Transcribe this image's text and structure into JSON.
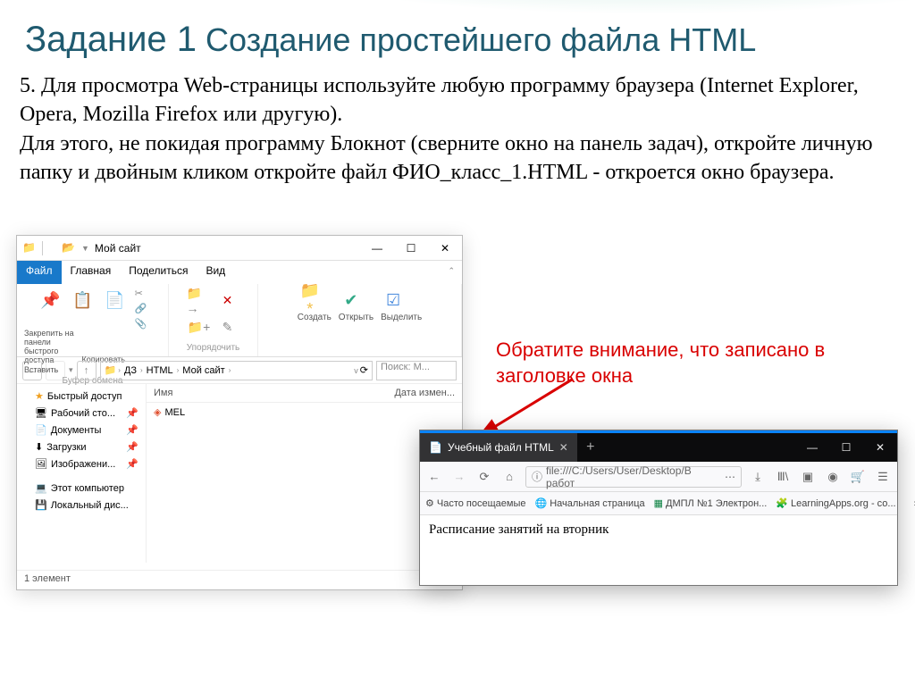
{
  "title_big": "Задание 1",
  "title_rest": "Создание простейшего файла HTML",
  "body_text": "5. Для просмотра Web-страницы используйте любую программу браузера (Internet Explorer, Opera, Mozilla Firefox или другую).\nДля этого, не покидая программу Блокнот (сверните окно на панель задач), откройте личную папку и двойным кликом откройте файл ФИО_класс_1.HTML   - откроется окно браузера.",
  "red_note": "Обратите внимание, что записано в заголовке окна",
  "explorer": {
    "window_title": "Мой сайт",
    "tabs": [
      "Файл",
      "Главная",
      "Поделиться",
      "Вид"
    ],
    "ribbon": {
      "pin_label": "Закрепить на панели быстрого доступа",
      "copy_label": "Копировать",
      "paste_label": "Вставить",
      "group_clipboard": "Буфер обмена",
      "group_organize": "Упорядочить",
      "create_label": "Создать",
      "open_label": "Открыть",
      "select_label": "Выделить"
    },
    "breadcrumb": [
      "ДЗ",
      "HTML",
      "Мой сайт"
    ],
    "search_placeholder": "Поиск: М...",
    "sidebar": [
      {
        "icon": "★",
        "label": "Быстрый доступ",
        "cls": "star"
      },
      {
        "icon": "🖥",
        "label": "Рабочий сто..."
      },
      {
        "icon": "📄",
        "label": "Документы"
      },
      {
        "icon": "⬇",
        "label": "Загрузки"
      },
      {
        "icon": "🖼",
        "label": "Изображени..."
      },
      {
        "icon": "💻",
        "label": "Этот компьютер"
      },
      {
        "icon": "💾",
        "label": "Локальный дис..."
      }
    ],
    "columns": {
      "name": "Имя",
      "date": "Дата измен..."
    },
    "files": [
      {
        "icon": "🔥",
        "name": "MEL"
      }
    ],
    "status": "1 элемент"
  },
  "browser": {
    "tab_title": "Учебный файл HTML",
    "url": "file:///C:/Users/User/Desktop/В работ",
    "url_prefix": "ⓘ",
    "bookmarks": [
      {
        "icon": "⚙",
        "label": "Часто посещаемые"
      },
      {
        "icon": "🌐",
        "label": "Начальная страница"
      },
      {
        "icon": "📗",
        "label": "ДМПЛ №1 Электрон..."
      },
      {
        "icon": "🧩",
        "label": "LearningApps.org - со..."
      }
    ],
    "page_text": "Расписание занятий на вторник"
  }
}
